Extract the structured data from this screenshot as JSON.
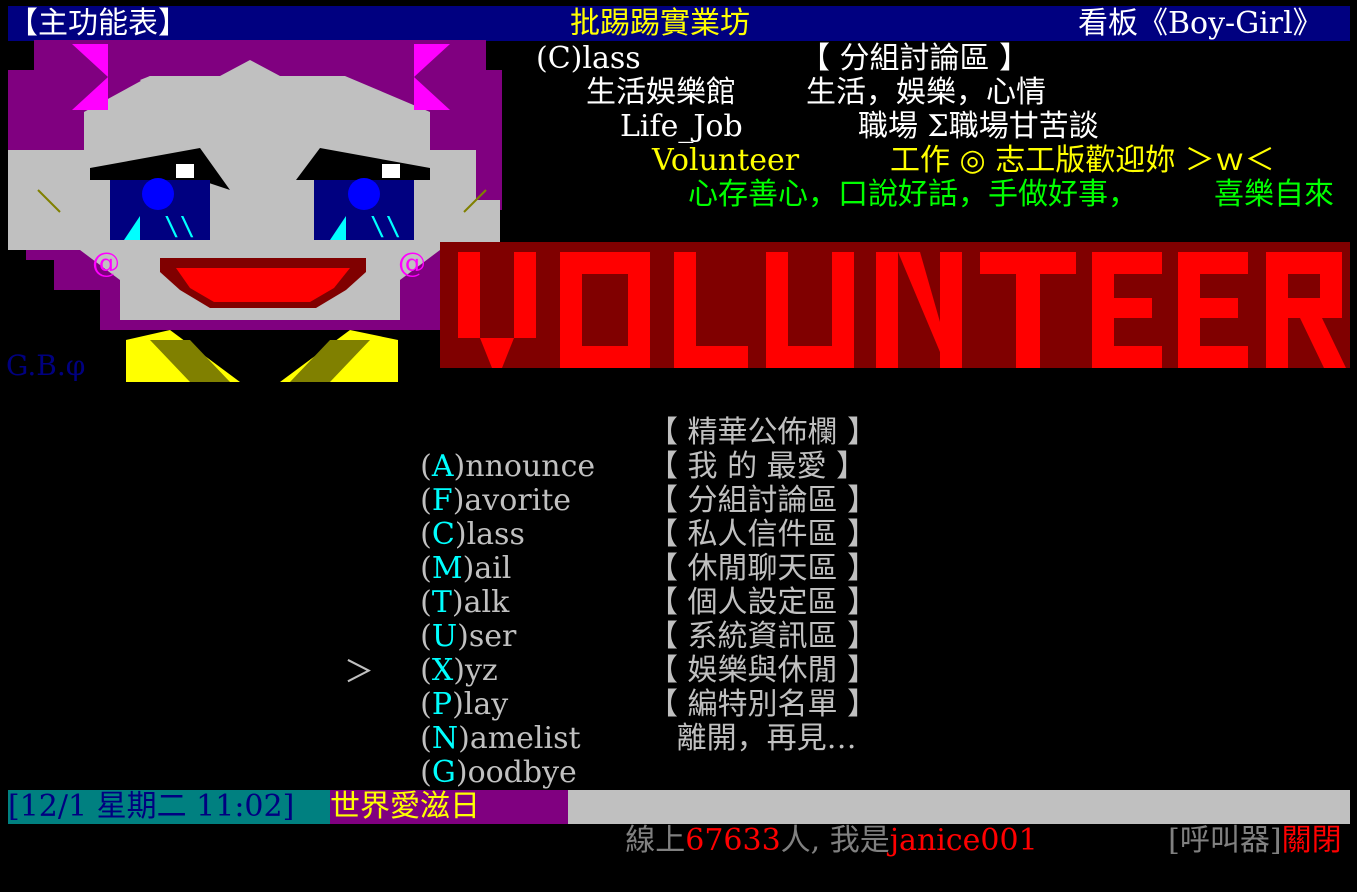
{
  "header": {
    "menu_title": "【主功能表】",
    "site_name": "批踢踢實業坊",
    "board_label": "看板《Boy-Girl》"
  },
  "breadcrumb": {
    "line1_key": "(C)lass",
    "line1_desc": "【 分組討論區 】",
    "line2_key": "生活娛樂館",
    "line2_desc": "生活，娛樂，心情",
    "line3_key": "Life_Job",
    "line3_desc": "職場 Σ職場甘苦談",
    "line4_key": "Volunteer",
    "line4_desc": "工作 ◎ 志工版歡迎妳 ＞ｗ＜",
    "slogan": "心存善心，口說好話，手做好事，",
    "slogan_tail": "喜樂自來"
  },
  "art": {
    "signature": "G.B.φ",
    "banner_word": "VOLUNTEER",
    "cheek_mark": "@"
  },
  "menu": {
    "cursor": "＞",
    "items": [
      {
        "key": "A",
        "rest": "nnounce",
        "desc": "【 精華公佈欄 】"
      },
      {
        "key": "F",
        "rest": "avorite",
        "desc": "【 我 的 最愛 】"
      },
      {
        "key": "C",
        "rest": "lass",
        "desc": "【 分組討論區 】"
      },
      {
        "key": "M",
        "rest": "ail",
        "desc": "【 私人信件區 】"
      },
      {
        "key": "T",
        "rest": "alk",
        "desc": "【 休閒聊天區 】"
      },
      {
        "key": "U",
        "rest": "ser",
        "desc": "【 個人設定區 】"
      },
      {
        "key": "X",
        "rest": "yz",
        "desc": "【 系統資訊區 】"
      },
      {
        "key": "P",
        "rest": "lay",
        "desc": "【 娛樂與休閒 】"
      },
      {
        "key": "N",
        "rest": "amelist",
        "desc": "【 編特別名單 】"
      },
      {
        "key": "G",
        "rest": "oodbye",
        "desc": "   離開，再見…"
      }
    ]
  },
  "footer": {
    "datetime": "[12/1 星期二 11:02]",
    "event": "世界愛滋日",
    "online_prefix": "  線上",
    "online_count": "67633",
    "online_mid": "人, 我是",
    "username": "janice001",
    "pager_label": "[呼叫器]",
    "pager_status": "關閉"
  },
  "colors": {
    "header_bg": "#000080",
    "header_fg": "#ffffff",
    "site_fg": "#ffff00",
    "menu_key": "#00ffff",
    "footer_date_bg": "#008080",
    "footer_event_bg": "#800080",
    "footer_status_bg": "#c0c0c0",
    "accent_red": "#ff0000"
  }
}
